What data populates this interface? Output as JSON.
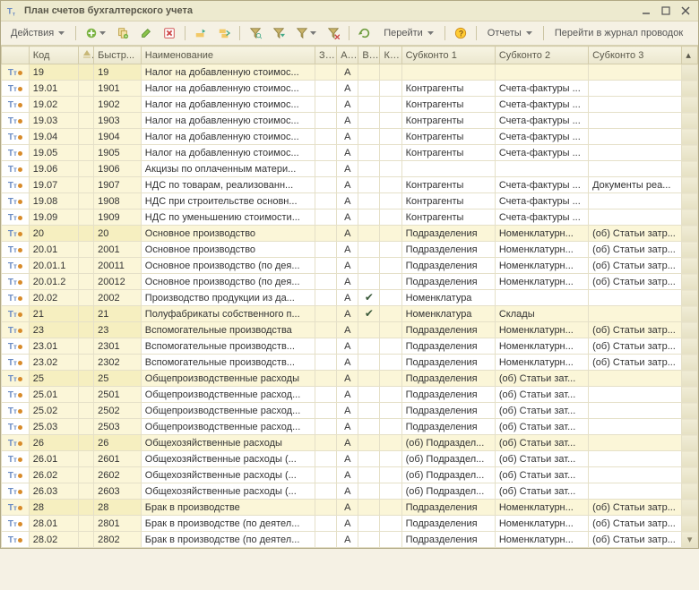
{
  "title": "План счетов бухгалтерского учета",
  "toolbar": {
    "actions_label": "Действия",
    "goto_label": "Перейти",
    "reports_label": "Отчеты",
    "journal_label": "Перейти в журнал проводок"
  },
  "columns": {
    "icon": "",
    "code": "Код",
    "sort": "",
    "fast": "Быстр...",
    "name": "Наименование",
    "z": "З...",
    "a": "А...",
    "v": "В...",
    "k": "К...",
    "s1": "Субконто 1",
    "s2": "Субконто 2",
    "s3": "Субконто 3"
  },
  "rows": [
    {
      "code": "19",
      "fast": "19",
      "name": "Налог на добавленную стоимос...",
      "a": "А",
      "s1": "",
      "s2": "",
      "s3": "",
      "yellow": true
    },
    {
      "code": "19.01",
      "fast": "1901",
      "name": "Налог на добавленную стоимос...",
      "a": "А",
      "s1": "Контрагенты",
      "s2": "Счета-фактуры ...",
      "s3": ""
    },
    {
      "code": "19.02",
      "fast": "1902",
      "name": "Налог на добавленную стоимос...",
      "a": "А",
      "s1": "Контрагенты",
      "s2": "Счета-фактуры ...",
      "s3": ""
    },
    {
      "code": "19.03",
      "fast": "1903",
      "name": "Налог на добавленную стоимос...",
      "a": "А",
      "s1": "Контрагенты",
      "s2": "Счета-фактуры ...",
      "s3": ""
    },
    {
      "code": "19.04",
      "fast": "1904",
      "name": "Налог на добавленную стоимос...",
      "a": "А",
      "s1": "Контрагенты",
      "s2": "Счета-фактуры ...",
      "s3": ""
    },
    {
      "code": "19.05",
      "fast": "1905",
      "name": "Налог на добавленную стоимос...",
      "a": "А",
      "s1": "Контрагенты",
      "s2": "Счета-фактуры ...",
      "s3": ""
    },
    {
      "code": "19.06",
      "fast": "1906",
      "name": "Акцизы по оплаченным матери...",
      "a": "А",
      "s1": "",
      "s2": "",
      "s3": ""
    },
    {
      "code": "19.07",
      "fast": "1907",
      "name": "НДС по товарам, реализованн...",
      "a": "А",
      "s1": "Контрагенты",
      "s2": "Счета-фактуры ...",
      "s3": "Документы реа..."
    },
    {
      "code": "19.08",
      "fast": "1908",
      "name": "НДС при строительстве основн...",
      "a": "А",
      "s1": "Контрагенты",
      "s2": "Счета-фактуры ...",
      "s3": ""
    },
    {
      "code": "19.09",
      "fast": "1909",
      "name": "НДС по уменьшению стоимости...",
      "a": "А",
      "s1": "Контрагенты",
      "s2": "Счета-фактуры ...",
      "s3": ""
    },
    {
      "code": "20",
      "fast": "20",
      "name": "Основное производство",
      "a": "А",
      "s1": "Подразделения",
      "s2": "Номенклатурн...",
      "s3": "(об) Статьи затр...",
      "yellow": true
    },
    {
      "code": "20.01",
      "fast": "2001",
      "name": "Основное производство",
      "a": "А",
      "s1": "Подразделения",
      "s2": "Номенклатурн...",
      "s3": "(об) Статьи затр..."
    },
    {
      "code": "20.01.1",
      "fast": "20011",
      "name": "Основное производство (по дея...",
      "a": "А",
      "s1": "Подразделения",
      "s2": "Номенклатурн...",
      "s3": "(об) Статьи затр..."
    },
    {
      "code": "20.01.2",
      "fast": "20012",
      "name": "Основное производство (по дея...",
      "a": "А",
      "s1": "Подразделения",
      "s2": "Номенклатурн...",
      "s3": "(об) Статьи затр..."
    },
    {
      "code": "20.02",
      "fast": "2002",
      "name": "Производство продукции из да...",
      "a": "А",
      "v": true,
      "s1": "Номенклатура",
      "s2": "",
      "s3": ""
    },
    {
      "code": "21",
      "fast": "21",
      "name": "Полуфабрикаты собственного п...",
      "a": "А",
      "v": true,
      "s1": "Номенклатура",
      "s2": "Склады",
      "s3": "",
      "yellow": true
    },
    {
      "code": "23",
      "fast": "23",
      "name": "Вспомогательные производства",
      "a": "А",
      "s1": "Подразделения",
      "s2": "Номенклатурн...",
      "s3": "(об) Статьи затр...",
      "yellow": true
    },
    {
      "code": "23.01",
      "fast": "2301",
      "name": "Вспомогательные производств...",
      "a": "А",
      "s1": "Подразделения",
      "s2": "Номенклатурн...",
      "s3": "(об) Статьи затр..."
    },
    {
      "code": "23.02",
      "fast": "2302",
      "name": "Вспомогательные производств...",
      "a": "А",
      "s1": "Подразделения",
      "s2": "Номенклатурн...",
      "s3": "(об) Статьи затр..."
    },
    {
      "code": "25",
      "fast": "25",
      "name": "Общепроизводственные расходы",
      "a": "А",
      "s1": "Подразделения",
      "s2": "(об) Статьи зат...",
      "s3": "",
      "yellow": true
    },
    {
      "code": "25.01",
      "fast": "2501",
      "name": "Общепроизводственные расход...",
      "a": "А",
      "s1": "Подразделения",
      "s2": "(об) Статьи зат...",
      "s3": ""
    },
    {
      "code": "25.02",
      "fast": "2502",
      "name": "Общепроизводственные расход...",
      "a": "А",
      "s1": "Подразделения",
      "s2": "(об) Статьи зат...",
      "s3": ""
    },
    {
      "code": "25.03",
      "fast": "2503",
      "name": "Общепроизводственные расход...",
      "a": "А",
      "s1": "Подразделения",
      "s2": "(об) Статьи зат...",
      "s3": ""
    },
    {
      "code": "26",
      "fast": "26",
      "name": "Общехозяйственные расходы",
      "a": "А",
      "s1": "(об) Подраздел...",
      "s2": "(об) Статьи зат...",
      "s3": "",
      "yellow": true
    },
    {
      "code": "26.01",
      "fast": "2601",
      "name": "Общехозяйственные расходы (...",
      "a": "А",
      "s1": "(об) Подраздел...",
      "s2": "(об) Статьи зат...",
      "s3": ""
    },
    {
      "code": "26.02",
      "fast": "2602",
      "name": "Общехозяйственные расходы (...",
      "a": "А",
      "s1": "(об) Подраздел...",
      "s2": "(об) Статьи зат...",
      "s3": ""
    },
    {
      "code": "26.03",
      "fast": "2603",
      "name": "Общехозяйственные расходы (...",
      "a": "А",
      "s1": "(об) Подраздел...",
      "s2": "(об) Статьи зат...",
      "s3": ""
    },
    {
      "code": "28",
      "fast": "28",
      "name": "Брак в производстве",
      "a": "А",
      "s1": "Подразделения",
      "s2": "Номенклатурн...",
      "s3": "(об) Статьи затр...",
      "yellow": true
    },
    {
      "code": "28.01",
      "fast": "2801",
      "name": "Брак в производстве (по деятел...",
      "a": "А",
      "s1": "Подразделения",
      "s2": "Номенклатурн...",
      "s3": "(об) Статьи затр..."
    },
    {
      "code": "28.02",
      "fast": "2802",
      "name": "Брак в производстве (по деятел...",
      "a": "А",
      "s1": "Подразделения",
      "s2": "Номенклатурн...",
      "s3": "(об) Статьи затр..."
    }
  ]
}
